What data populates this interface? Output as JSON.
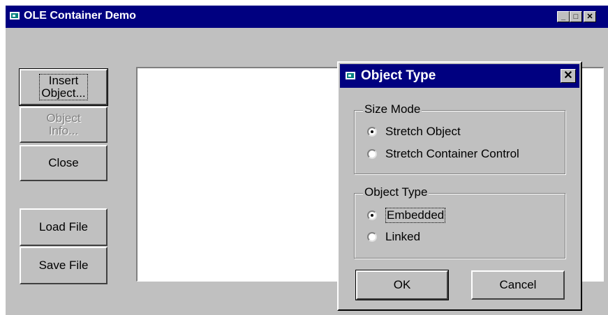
{
  "window": {
    "title": "OLE Container Demo",
    "minimize": "_",
    "maximize": "□",
    "close": "✕"
  },
  "buttons": {
    "insert_object": "Insert\nObject...",
    "object_info": "Object\nInfo...",
    "close": "Close",
    "load_file": "Load File",
    "save_file": "Save File"
  },
  "dialog": {
    "title": "Object Type",
    "close": "✕",
    "size_mode": {
      "label": "Size Mode",
      "options": [
        "Stretch Object",
        "Stretch Container Control"
      ],
      "selected": "Stretch Object"
    },
    "object_type": {
      "label": "Object Type",
      "options": [
        "Embedded",
        "Linked"
      ],
      "selected": "Embedded"
    },
    "ok": "OK",
    "cancel": "Cancel"
  }
}
